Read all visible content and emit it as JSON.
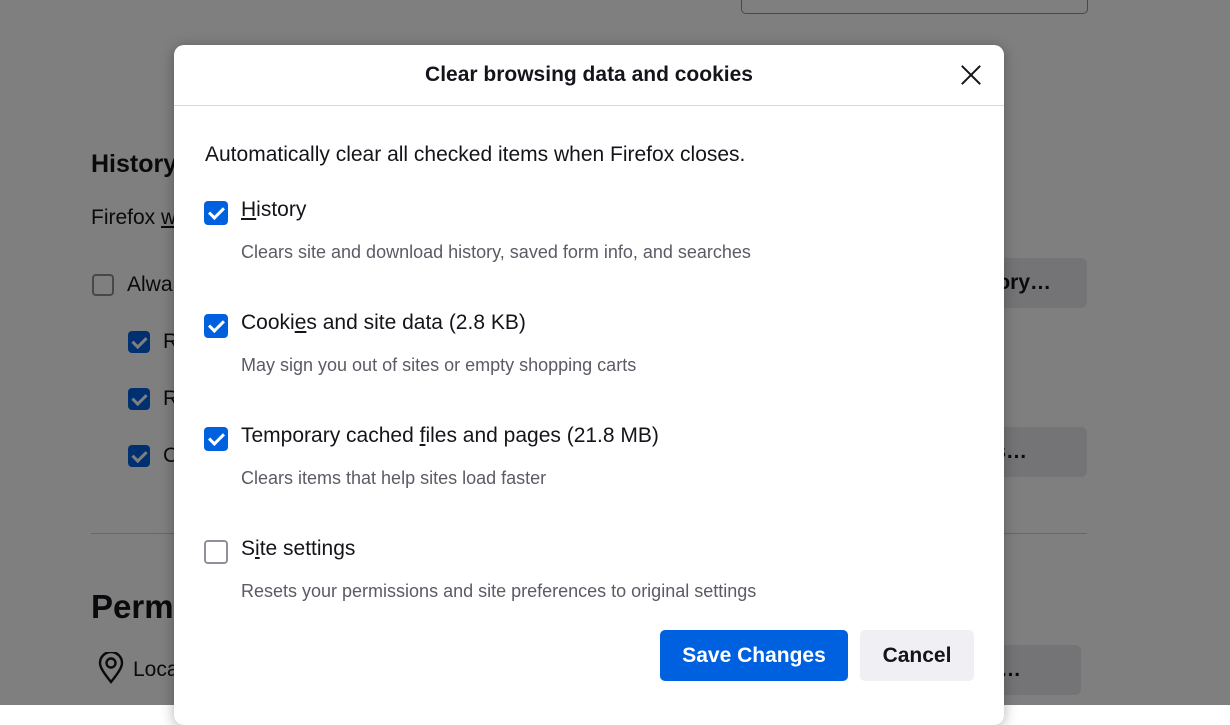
{
  "background": {
    "history_heading": "History",
    "firefox_text_pre": "Firefox ",
    "firefox_text_key": "w",
    "always_label": "Alwa",
    "sub_items": [
      "R",
      "R",
      "C"
    ],
    "history_button": "ory…",
    "settings_button": "s…",
    "permissions_heading": "Permi",
    "location_label": "Loca",
    "location_button": "…"
  },
  "dialog": {
    "title": "Clear browsing data and cookies",
    "intro": "Automatically clear all checked items when Firefox closes.",
    "options": [
      {
        "pre": "",
        "key": "H",
        "post": "istory",
        "desc": "Clears site and download history, saved form info, and searches",
        "checked": true
      },
      {
        "pre": "Cooki",
        "key": "e",
        "post": "s and site data (2.8 KB)",
        "desc": "May sign you out of sites or empty shopping carts",
        "checked": true
      },
      {
        "pre": "Temporary cached ",
        "key": "f",
        "post": "iles and pages (21.8 MB)",
        "desc": "Clears items that help sites load faster",
        "checked": true
      },
      {
        "pre": "S",
        "key": "i",
        "post": "te settings",
        "desc": "Resets your permissions and site preferences to original settings",
        "checked": false
      }
    ],
    "save_label": "Save Changes",
    "cancel_label": "Cancel"
  },
  "colors": {
    "accent": "#0061e0",
    "overlay": "rgba(0,0,0,0.5)"
  }
}
